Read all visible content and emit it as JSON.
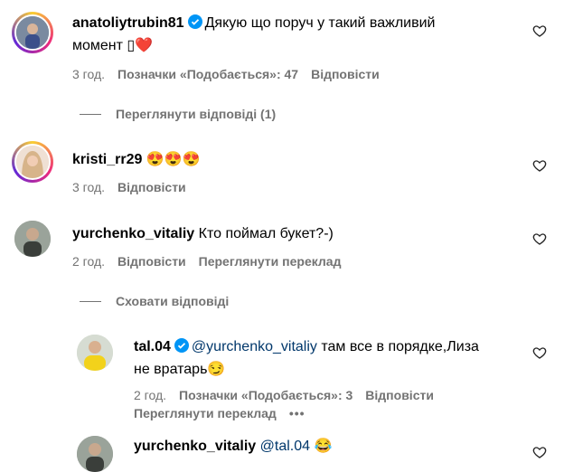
{
  "comments": [
    {
      "username": "anatoliytrubin81",
      "text_line1": "Дякую що поруч у такий важливий",
      "text_line2": "момент",
      "emoji": "▯❤️",
      "time": "3 год.",
      "likes": "Позначки «Подобається»: 47",
      "reply": "Відповісти"
    },
    {
      "username": "kristi_rr29",
      "emoji": "😍😍😍",
      "time": "3 год.",
      "reply": "Відповісти"
    },
    {
      "username": "yurchenko_vitaliy",
      "text": "Кто поймал букет?-)",
      "time": "2 год.",
      "reply": "Відповісти",
      "translate": "Переглянути переклад"
    }
  ],
  "threads": {
    "view_replies": "Переглянути відповіді (1)",
    "hide_replies": "Сховати відповіді"
  },
  "replies": [
    {
      "username": "tal.04",
      "mention": "@yurchenko_vitaliy",
      "text_line1": "там все в порядке,Лиза",
      "text_line2": "не вратарь",
      "emoji": "😏",
      "time": "2 год.",
      "likes": "Позначки «Подобається»: 3",
      "reply": "Відповісти",
      "translate": "Переглянути переклад",
      "more": "•••"
    },
    {
      "username": "yurchenko_vitaliy",
      "mention": "@tal.04",
      "emoji": "😂"
    }
  ],
  "colors": {
    "secondary_text": "#737373",
    "verified_blue": "#0095f6",
    "heart_red": "#ed1c40",
    "mention_blue": "#00376b"
  }
}
